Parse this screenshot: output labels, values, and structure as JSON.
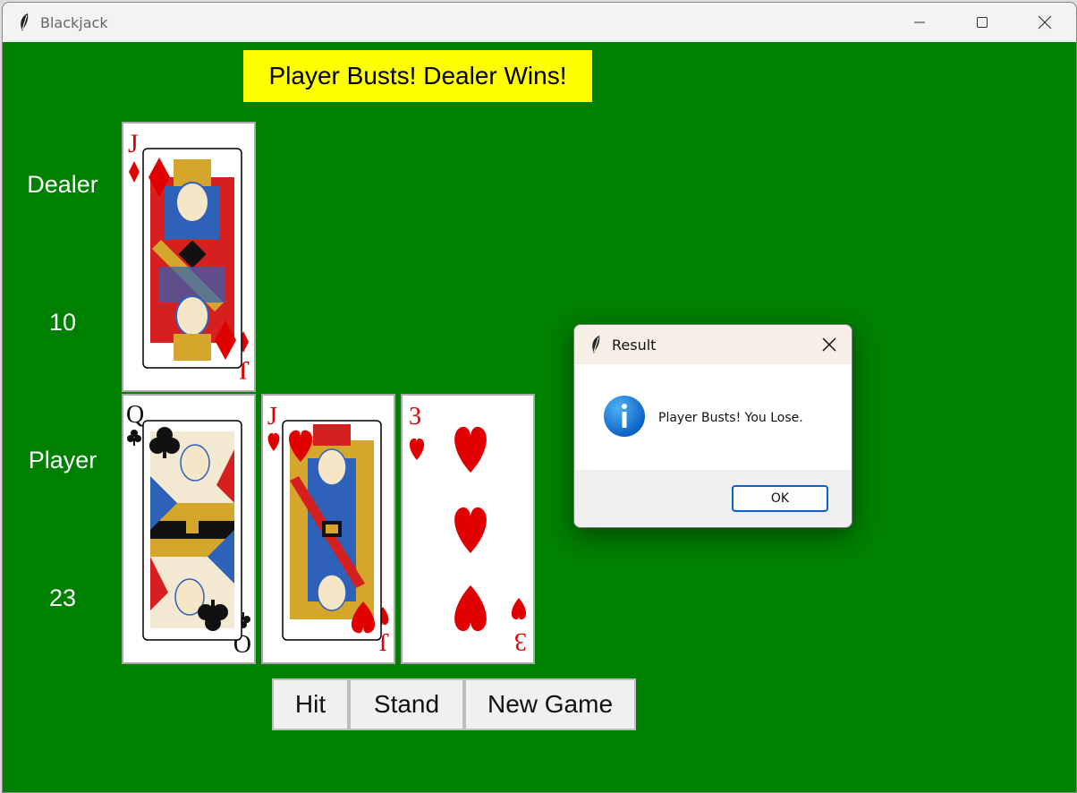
{
  "window": {
    "title": "Blackjack",
    "app_icon": "feather-icon",
    "controls": [
      "minimize-icon",
      "maximize-icon",
      "close-icon"
    ]
  },
  "status_message": "Player Busts! Dealer Wins!",
  "dealer": {
    "label": "Dealer",
    "score": "10",
    "cards": [
      {
        "rank": "J",
        "suit": "diamonds"
      }
    ]
  },
  "player": {
    "label": "Player",
    "score": "23",
    "cards": [
      {
        "rank": "Q",
        "suit": "clubs"
      },
      {
        "rank": "J",
        "suit": "hearts"
      },
      {
        "rank": "3",
        "suit": "hearts"
      }
    ]
  },
  "buttons": {
    "hit": "Hit",
    "stand": "Stand",
    "new_game": "New Game"
  },
  "dialog": {
    "title": "Result",
    "message": "Player Busts! You Lose.",
    "ok_label": "OK",
    "icon": "info-icon"
  },
  "colors": {
    "table_green": "#008000",
    "status_bg": "#ffff00",
    "red_suit": "#e00000",
    "info_blue": "#1478d4"
  }
}
